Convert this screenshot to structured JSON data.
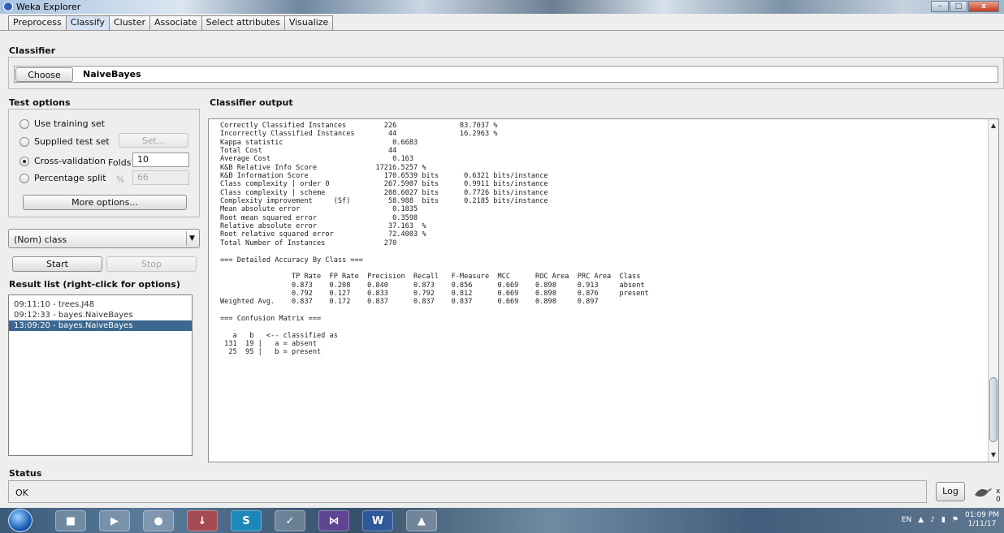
{
  "window": {
    "title": "Weka Explorer",
    "min": "–",
    "max": "□",
    "close": "x"
  },
  "tabs": [
    "Preprocess",
    "Classify",
    "Cluster",
    "Associate",
    "Select attributes",
    "Visualize"
  ],
  "classifier": {
    "section": "Classifier",
    "choose_label": "Choose",
    "name": "NaiveBayes"
  },
  "test_options": {
    "section": "Test options",
    "use_training": "Use training set",
    "supplied": "Supplied test set",
    "set_button": "Set...",
    "cross_validation": "Cross-validation",
    "folds_label": "Folds",
    "folds_value": "10",
    "percentage_split": "Percentage split",
    "percent_symbol": "%",
    "percent_value": "66",
    "more_options": "More options...",
    "selected": "cross_validation"
  },
  "class_select": "(Nom) class",
  "start_label": "Start",
  "stop_label": "Stop",
  "result_list": {
    "section": "Result list (right-click for options)",
    "items": [
      "09:11:10 - trees.J48",
      "09:12:33 - bayes.NaiveBayes",
      "13:09:20 - bayes.NaiveBayes"
    ],
    "selected_index": 2
  },
  "output": {
    "section": "Classifier output",
    "lines": [
      "Correctly Classified Instances         226               83.7037 %",
      "Incorrectly Classified Instances        44               16.2963 %",
      "Kappa statistic                          0.6683",
      "Total Cost                              44",
      "Average Cost                             0.163",
      "K&B Relative Info Score              17216.5257 %",
      "K&B Information Score                  170.6539 bits      0.6321 bits/instance",
      "Class complexity | order 0             267.5907 bits      0.9911 bits/instance",
      "Class complexity | scheme              208.6027 bits      0.7726 bits/instance",
      "Complexity improvement     (Sf)         58.988  bits      0.2185 bits/instance",
      "Mean absolute error                      0.1835",
      "Root mean squared error                  0.3598",
      "Relative absolute error                 37.163  %",
      "Root relative squared error             72.4003 %",
      "Total Number of Instances              270",
      "",
      "=== Detailed Accuracy By Class ===",
      "",
      "                 TP Rate  FP Rate  Precision  Recall   F-Measure  MCC      ROC Area  PRC Area  Class",
      "                 0.873    0.208    0.840      0.873    0.856      0.669    0.898     0.913     absent",
      "                 0.792    0.127    0.833      0.792    0.812      0.669    0.898     0.876     present",
      "Weighted Avg.    0.837    0.172    0.837      0.837    0.837      0.669    0.898     0.897",
      "",
      "=== Confusion Matrix ===",
      "",
      "   a   b   <-- classified as",
      " 131  19 |   a = absent",
      "  25  95 |   b = present"
    ]
  },
  "status": {
    "section": "Status",
    "text": "OK",
    "log_label": "Log",
    "x_count": "x 0"
  },
  "taskbar": {
    "lang": "EN",
    "time": "01:09 PM",
    "date": "1/11/17"
  }
}
